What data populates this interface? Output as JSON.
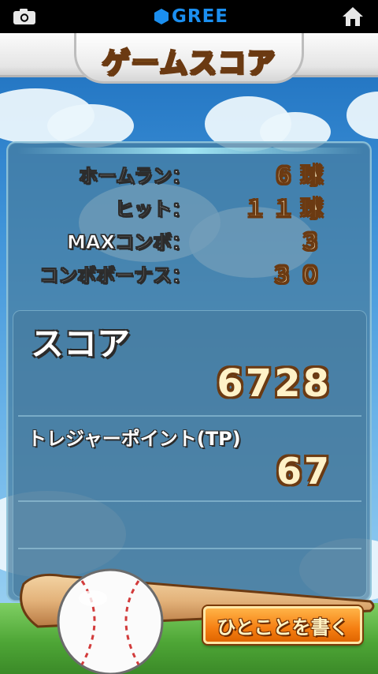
{
  "topbar": {
    "brand": "GREE",
    "camera_icon": "camera-icon",
    "home_icon": "home-icon"
  },
  "banner": {
    "title": "ゲームスコア"
  },
  "stats": [
    {
      "label": "ホームラン：",
      "value": "６球"
    },
    {
      "label": "ヒット：",
      "value": "１１球"
    },
    {
      "label": "MAXコンボ：",
      "value": "３"
    },
    {
      "label": "コンボボーナス：",
      "value": "３０"
    }
  ],
  "score": {
    "label": "スコア",
    "value": "6728"
  },
  "treasure": {
    "label": "トレジャーポイント(TP)",
    "value": "67"
  },
  "comment_button": {
    "label": "ひとことを書く"
  },
  "colors": {
    "brand": "#1b8ff0",
    "accent": "#ffd23a",
    "button": "#f57f12"
  }
}
